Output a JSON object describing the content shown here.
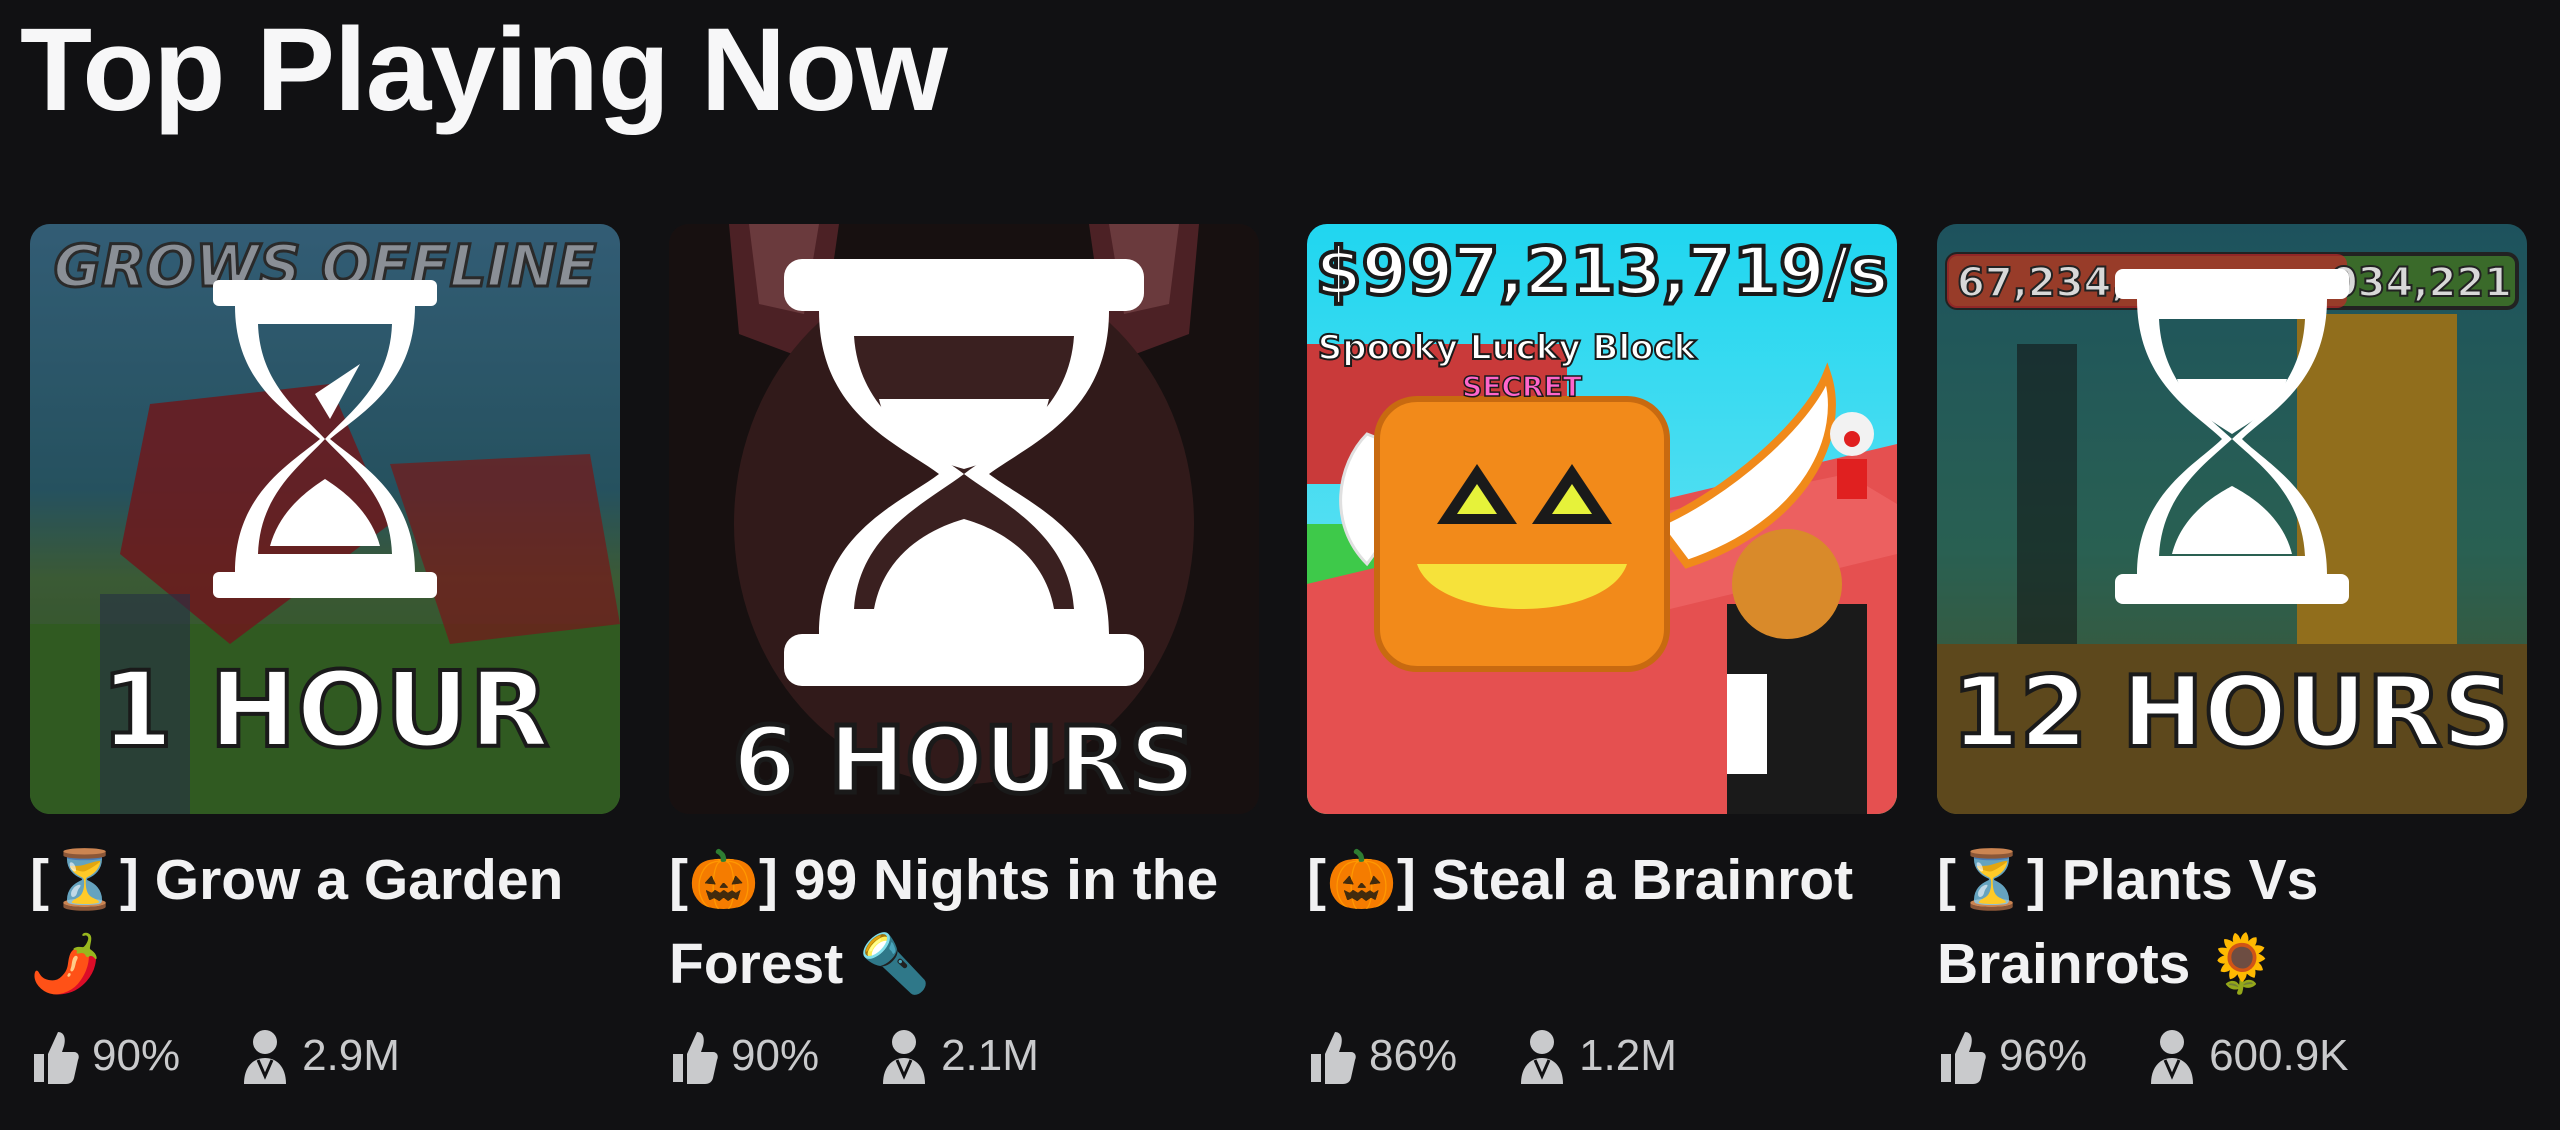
{
  "section": {
    "title": "Top Playing Now"
  },
  "games": [
    {
      "name": "[⏳] Grow a Garden 🌶️",
      "overlay_text": "1 HOUR",
      "banner_text": "GROWS OFFLINE",
      "rating": "90%",
      "players": "2.9M"
    },
    {
      "name": "[🎃] 99 Nights in the Forest 🔦",
      "overlay_text": "6 HOURS",
      "rating": "90%",
      "players": "2.1M"
    },
    {
      "name": "[🎃] Steal a Brainrot",
      "money_text": "$997,213,719/s",
      "item_text": "Spooky Lucky Block",
      "rarity_text": "SECRET",
      "rating": "86%",
      "players": "1.2M"
    },
    {
      "name": "[⏳] Plants Vs Brainrots 🌻",
      "overlay_text": "12 HOURS",
      "counter_text": "67,234,",
      "counter_text_right": "034,221",
      "rating": "96%",
      "players": "600.9K"
    }
  ],
  "colors": {
    "background": "#111113",
    "title": "#f7f7f8",
    "stat_text": "#c9cacc"
  }
}
